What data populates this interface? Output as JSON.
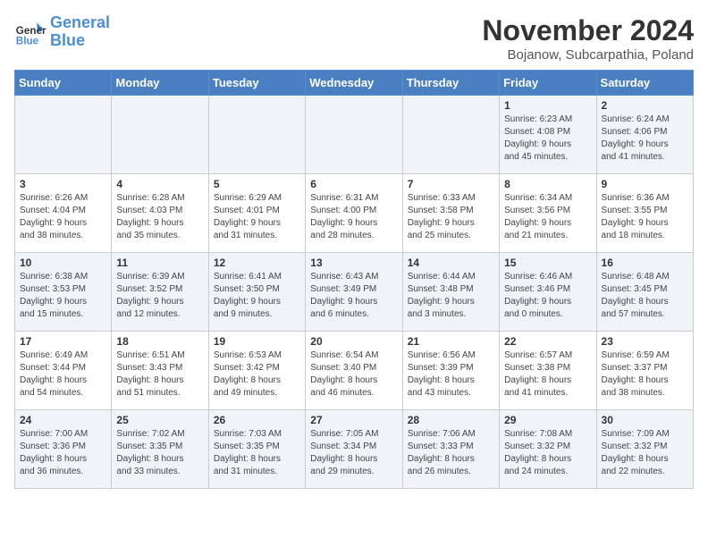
{
  "logo": {
    "line1": "General",
    "line2": "Blue"
  },
  "title": "November 2024",
  "subtitle": "Bojanow, Subcarpathia, Poland",
  "headers": [
    "Sunday",
    "Monday",
    "Tuesday",
    "Wednesday",
    "Thursday",
    "Friday",
    "Saturday"
  ],
  "weeks": [
    [
      {
        "day": "",
        "info": ""
      },
      {
        "day": "",
        "info": ""
      },
      {
        "day": "",
        "info": ""
      },
      {
        "day": "",
        "info": ""
      },
      {
        "day": "",
        "info": ""
      },
      {
        "day": "1",
        "info": "Sunrise: 6:23 AM\nSunset: 4:08 PM\nDaylight: 9 hours\nand 45 minutes."
      },
      {
        "day": "2",
        "info": "Sunrise: 6:24 AM\nSunset: 4:06 PM\nDaylight: 9 hours\nand 41 minutes."
      }
    ],
    [
      {
        "day": "3",
        "info": "Sunrise: 6:26 AM\nSunset: 4:04 PM\nDaylight: 9 hours\nand 38 minutes."
      },
      {
        "day": "4",
        "info": "Sunrise: 6:28 AM\nSunset: 4:03 PM\nDaylight: 9 hours\nand 35 minutes."
      },
      {
        "day": "5",
        "info": "Sunrise: 6:29 AM\nSunset: 4:01 PM\nDaylight: 9 hours\nand 31 minutes."
      },
      {
        "day": "6",
        "info": "Sunrise: 6:31 AM\nSunset: 4:00 PM\nDaylight: 9 hours\nand 28 minutes."
      },
      {
        "day": "7",
        "info": "Sunrise: 6:33 AM\nSunset: 3:58 PM\nDaylight: 9 hours\nand 25 minutes."
      },
      {
        "day": "8",
        "info": "Sunrise: 6:34 AM\nSunset: 3:56 PM\nDaylight: 9 hours\nand 21 minutes."
      },
      {
        "day": "9",
        "info": "Sunrise: 6:36 AM\nSunset: 3:55 PM\nDaylight: 9 hours\nand 18 minutes."
      }
    ],
    [
      {
        "day": "10",
        "info": "Sunrise: 6:38 AM\nSunset: 3:53 PM\nDaylight: 9 hours\nand 15 minutes."
      },
      {
        "day": "11",
        "info": "Sunrise: 6:39 AM\nSunset: 3:52 PM\nDaylight: 9 hours\nand 12 minutes."
      },
      {
        "day": "12",
        "info": "Sunrise: 6:41 AM\nSunset: 3:50 PM\nDaylight: 9 hours\nand 9 minutes."
      },
      {
        "day": "13",
        "info": "Sunrise: 6:43 AM\nSunset: 3:49 PM\nDaylight: 9 hours\nand 6 minutes."
      },
      {
        "day": "14",
        "info": "Sunrise: 6:44 AM\nSunset: 3:48 PM\nDaylight: 9 hours\nand 3 minutes."
      },
      {
        "day": "15",
        "info": "Sunrise: 6:46 AM\nSunset: 3:46 PM\nDaylight: 9 hours\nand 0 minutes."
      },
      {
        "day": "16",
        "info": "Sunrise: 6:48 AM\nSunset: 3:45 PM\nDaylight: 8 hours\nand 57 minutes."
      }
    ],
    [
      {
        "day": "17",
        "info": "Sunrise: 6:49 AM\nSunset: 3:44 PM\nDaylight: 8 hours\nand 54 minutes."
      },
      {
        "day": "18",
        "info": "Sunrise: 6:51 AM\nSunset: 3:43 PM\nDaylight: 8 hours\nand 51 minutes."
      },
      {
        "day": "19",
        "info": "Sunrise: 6:53 AM\nSunset: 3:42 PM\nDaylight: 8 hours\nand 49 minutes."
      },
      {
        "day": "20",
        "info": "Sunrise: 6:54 AM\nSunset: 3:40 PM\nDaylight: 8 hours\nand 46 minutes."
      },
      {
        "day": "21",
        "info": "Sunrise: 6:56 AM\nSunset: 3:39 PM\nDaylight: 8 hours\nand 43 minutes."
      },
      {
        "day": "22",
        "info": "Sunrise: 6:57 AM\nSunset: 3:38 PM\nDaylight: 8 hours\nand 41 minutes."
      },
      {
        "day": "23",
        "info": "Sunrise: 6:59 AM\nSunset: 3:37 PM\nDaylight: 8 hours\nand 38 minutes."
      }
    ],
    [
      {
        "day": "24",
        "info": "Sunrise: 7:00 AM\nSunset: 3:36 PM\nDaylight: 8 hours\nand 36 minutes."
      },
      {
        "day": "25",
        "info": "Sunrise: 7:02 AM\nSunset: 3:35 PM\nDaylight: 8 hours\nand 33 minutes."
      },
      {
        "day": "26",
        "info": "Sunrise: 7:03 AM\nSunset: 3:35 PM\nDaylight: 8 hours\nand 31 minutes."
      },
      {
        "day": "27",
        "info": "Sunrise: 7:05 AM\nSunset: 3:34 PM\nDaylight: 8 hours\nand 29 minutes."
      },
      {
        "day": "28",
        "info": "Sunrise: 7:06 AM\nSunset: 3:33 PM\nDaylight: 8 hours\nand 26 minutes."
      },
      {
        "day": "29",
        "info": "Sunrise: 7:08 AM\nSunset: 3:32 PM\nDaylight: 8 hours\nand 24 minutes."
      },
      {
        "day": "30",
        "info": "Sunrise: 7:09 AM\nSunset: 3:32 PM\nDaylight: 8 hours\nand 22 minutes."
      }
    ]
  ]
}
